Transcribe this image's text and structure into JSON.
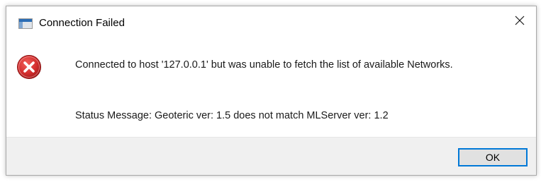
{
  "window": {
    "title": "Connection Failed",
    "app_icon": "dialog-window-icon",
    "close_icon": "close-icon"
  },
  "content": {
    "icon": "error-icon",
    "message": "Connected to host '127.0.0.1' but was unable to fetch the list of available Networks.",
    "status_message": "Status Message: Geoteric ver: 1.5 does not match MLServer ver: 1.2"
  },
  "footer": {
    "ok_label": "OK"
  },
  "colors": {
    "accent": "#0078d7",
    "error_red": "#d32f2f",
    "footer_bg": "#f0f0f0"
  }
}
